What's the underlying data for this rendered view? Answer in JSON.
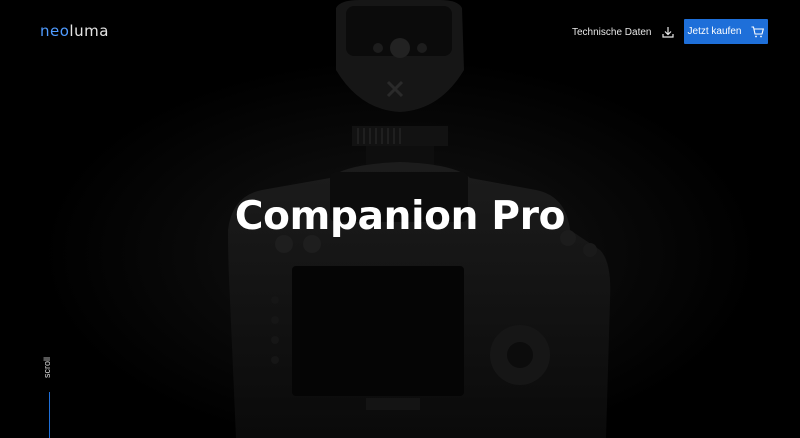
{
  "brand": {
    "prefix": "neo",
    "suffix": "luma"
  },
  "header": {
    "tech_link_label": "Technische Daten",
    "tech_link_icon": "download-icon",
    "buy_button_label": "Jetzt kaufen",
    "buy_button_icon": "cart-icon"
  },
  "hero": {
    "title": "Companion Pro",
    "scroll_label": "scroll"
  },
  "colors": {
    "accent": "#1e6fd9",
    "logo_accent": "#4f9bff",
    "background": "#000000"
  }
}
